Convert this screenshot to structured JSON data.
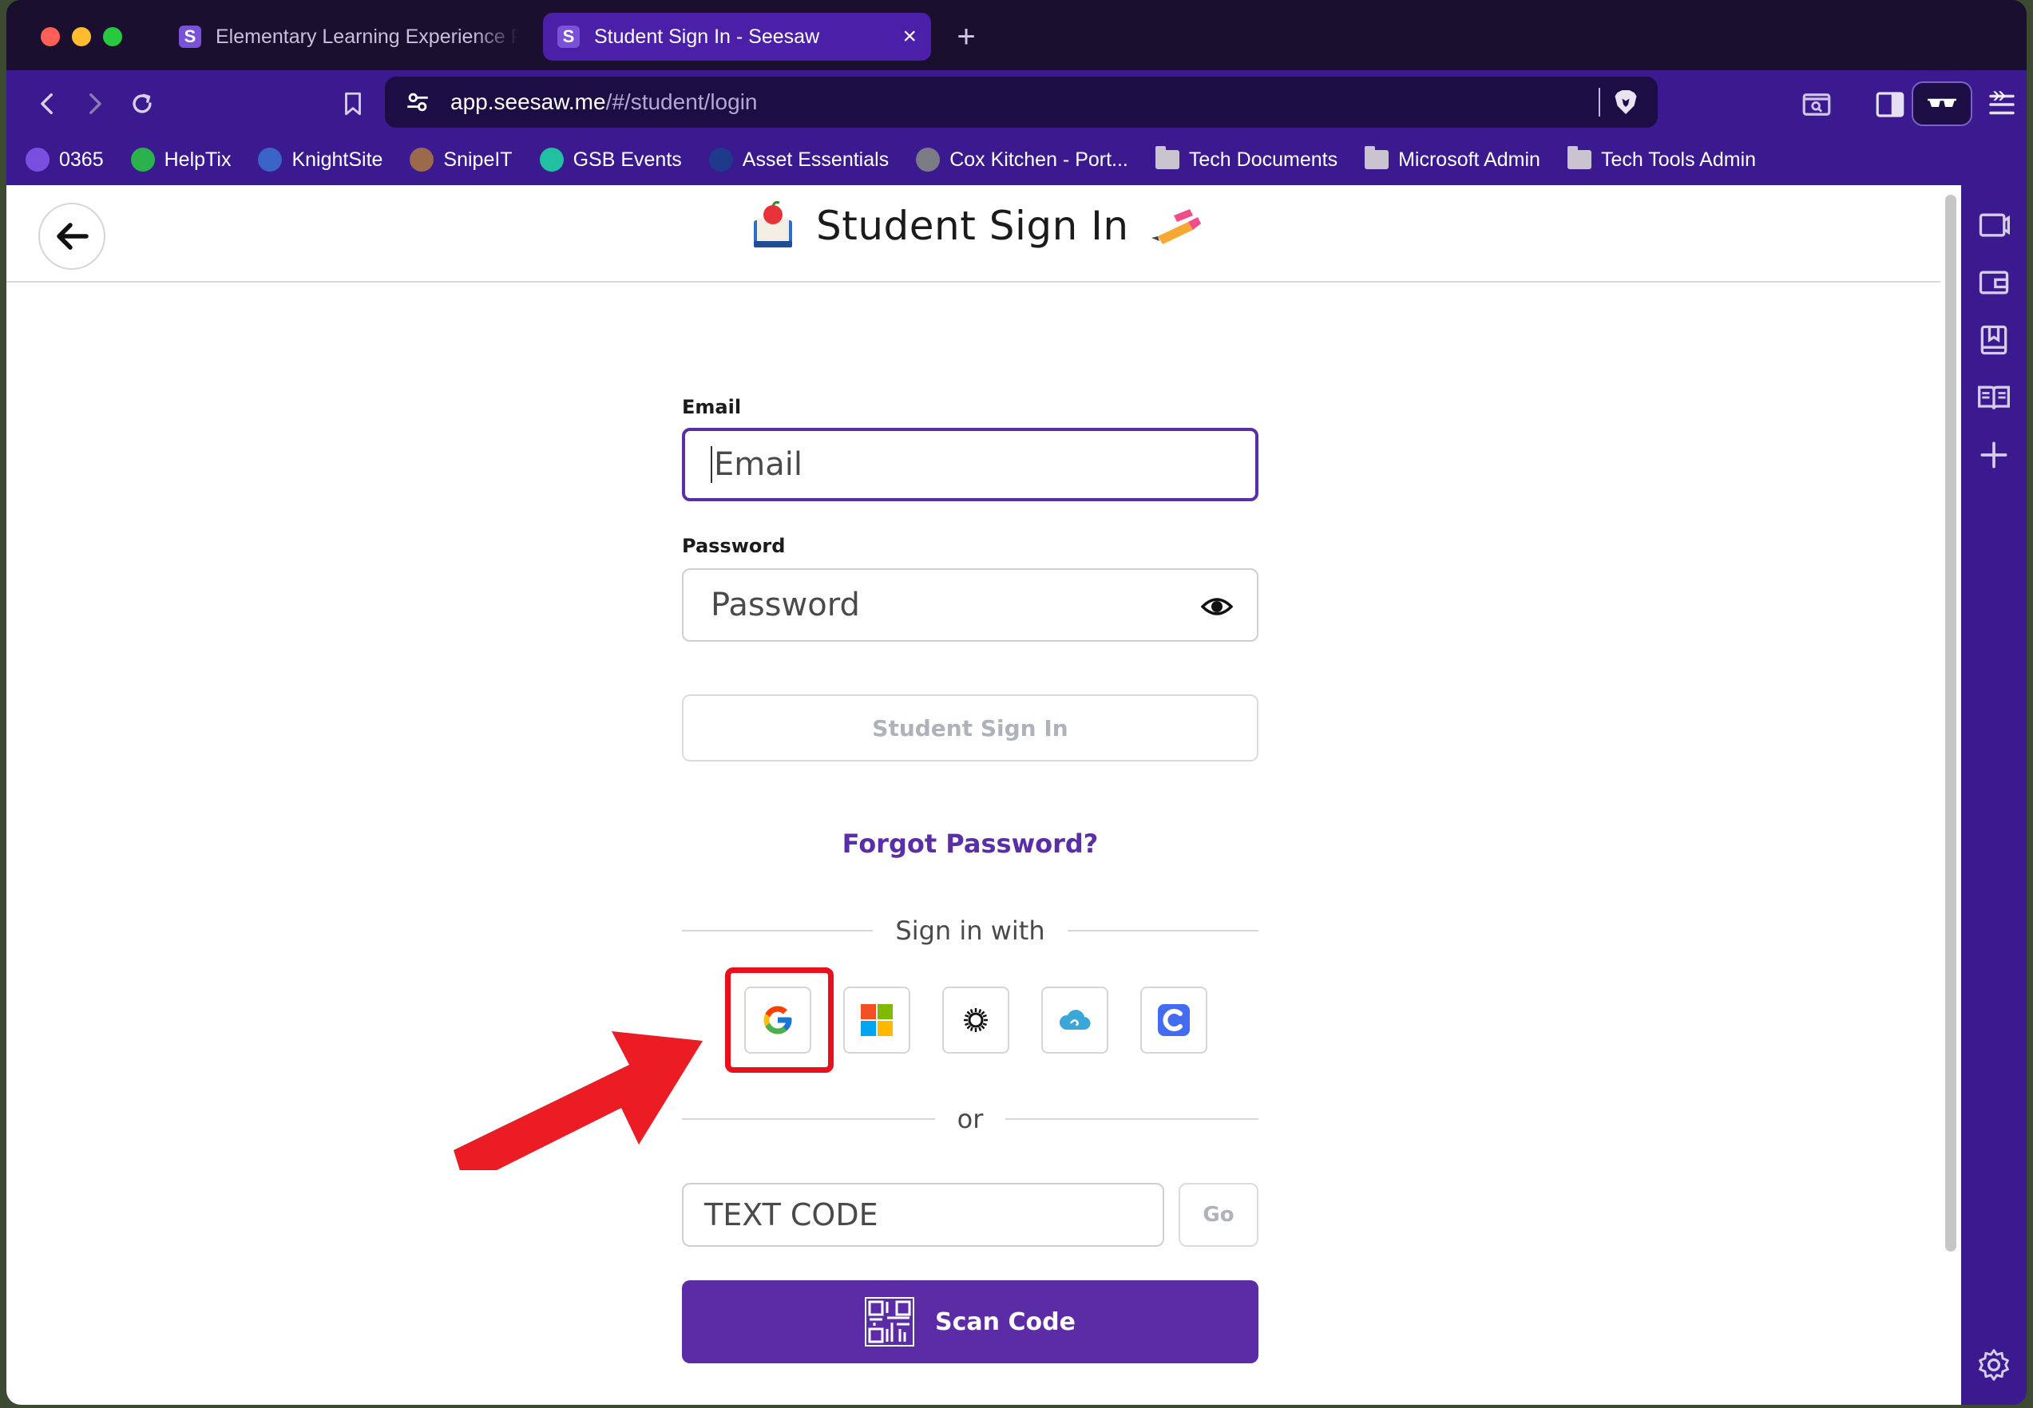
{
  "browser": {
    "tabs": [
      {
        "title": "Elementary Learning Experience Pl",
        "favicon": "seesaw-icon"
      },
      {
        "title": "Student Sign In - Seesaw",
        "favicon": "seesaw-icon"
      }
    ],
    "url": {
      "host": "app.seesaw.me",
      "path": "/#/student/login"
    },
    "bookmarks": [
      {
        "label": "0365",
        "icon": "copilot-icon",
        "color": "#7a4fe0"
      },
      {
        "label": "HelpTix",
        "icon": "headset-icon",
        "color": "#2bb24c"
      },
      {
        "label": "KnightSite",
        "icon": "knight-icon",
        "color": "#3a64c8"
      },
      {
        "label": "SnipeIT",
        "icon": "snipeit-icon",
        "color": "#9a6a4a"
      },
      {
        "label": "GSB Events",
        "icon": "events-icon",
        "color": "#21c0a0"
      },
      {
        "label": "Asset Essentials",
        "icon": "asset-icon",
        "color": "#1f3a8a"
      },
      {
        "label": "Cox Kitchen - Port...",
        "icon": "globe-icon",
        "color": "#7c7c86"
      },
      {
        "label": "Tech Documents",
        "icon": "folder-icon"
      },
      {
        "label": "Microsoft Admin",
        "icon": "folder-icon"
      },
      {
        "label": "Tech Tools Admin",
        "icon": "folder-icon"
      }
    ]
  },
  "page": {
    "title": "Student Sign In",
    "email_label": "Email",
    "email_placeholder": "Email",
    "password_label": "Password",
    "password_placeholder": "Password",
    "sign_in_button": "Student Sign In",
    "forgot_password": "Forgot Password?",
    "sign_in_with": "Sign in with",
    "sso_providers": [
      "google-icon",
      "microsoft-icon",
      "clever-sunburst-icon",
      "classlink-icon",
      "clever-icon"
    ],
    "or": "or",
    "text_code_placeholder": "TEXT CODE",
    "go_button": "Go",
    "scan_code_button": "Scan Code"
  },
  "colors": {
    "brand_purple": "#5b2ca5",
    "browser_purple": "#3b1a90",
    "highlight_red": "#e8101a"
  }
}
